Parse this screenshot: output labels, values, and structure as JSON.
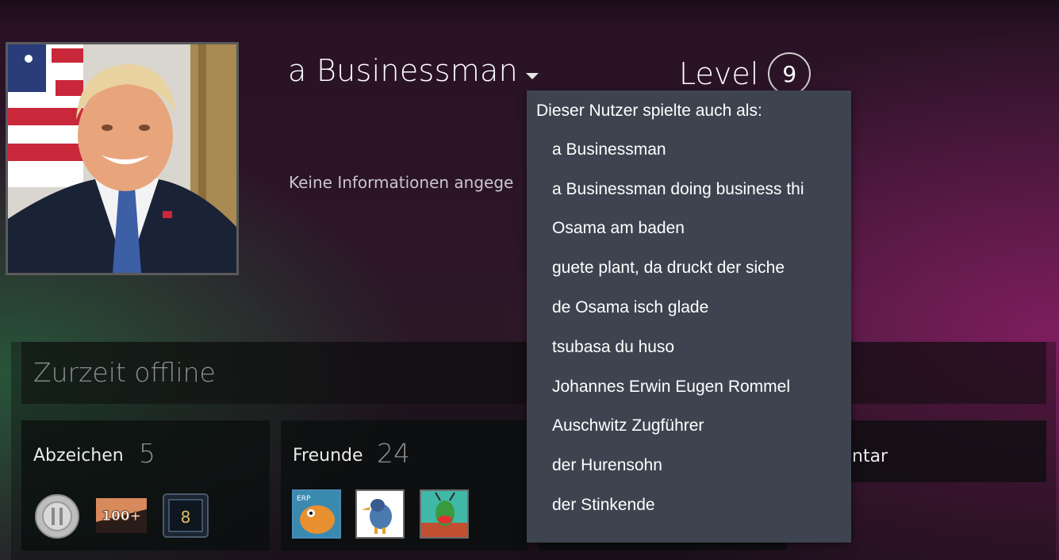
{
  "profile": {
    "persona_name": "a Businessman",
    "summary": "Keine Informationen angege",
    "level_label": "Level",
    "level_value": "9",
    "avatar": "profile-photo"
  },
  "status": {
    "text": "Zurzeit offline"
  },
  "cards": {
    "badges": {
      "label": "Abzeichen",
      "count": "5",
      "icons": [
        "silver-coin-badge-icon",
        "100-plus-badge-icon",
        "years-of-service-8-badge-icon"
      ]
    },
    "friends": {
      "label": "Freunde",
      "count": "24",
      "avatars": [
        "friend-avatar-orange-creature",
        "friend-avatar-cartoon-duck",
        "friend-avatar-cartoon-alien"
      ]
    },
    "right_card_label": "ntar"
  },
  "alias_menu": {
    "header": "Dieser Nutzer spielte auch als:",
    "items": [
      "a Businessman",
      "a Businessman doing business thi",
      "Osama am baden",
      "guete plant, da druckt der siche",
      "de Osama isch glade",
      "tsubasa du huso",
      "Johannes Erwin Eugen Rommel",
      "Auschwitz Zugführer",
      "der Hurensohn",
      "der Stinkende"
    ]
  },
  "colors": {
    "menu_bg": "#3d4450",
    "background": "#2a1226",
    "accent_green": "#285f3c",
    "accent_magenta": "#871e64"
  }
}
